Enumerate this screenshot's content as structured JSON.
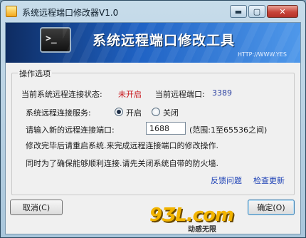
{
  "window": {
    "title": "系统远程端口修改器V1.0",
    "min_label": "▬",
    "max_label": "▢",
    "close_label": "✕"
  },
  "banner": {
    "prompt": ">_",
    "title": "系统远程端口修改工具",
    "url": "HTTP://WWW.YES"
  },
  "options": {
    "group_label": "操作选项",
    "status_label": "当前系统远程连接状态:",
    "status_value": "未开启",
    "port_label": "当前远程端口:",
    "port_value": "3389",
    "service_label": "系统远程连接服务:",
    "radio_on": "开启",
    "radio_off": "关闭",
    "radio_selected": "开启",
    "new_port_label": "请输入新的远程连接端口:",
    "new_port_value": "1688",
    "range_hint": "(范围:1至65536之间)",
    "note1": "修改完毕后请重启系统.来完成远程连接端口的修改操作.",
    "note2": "同时为了确保能够顺利连接.请先关闭系统自带的防火墙.",
    "feedback_link": "反馈问题",
    "update_link": "检查更新"
  },
  "footer": {
    "cancel_label": "取消(C)",
    "ok_label": "确定(O)",
    "watermark": "9ƷL.com",
    "watermark_sub": "动感无限"
  },
  "colors": {
    "status_off": "#c8141a",
    "port_value": "#2a3fa0",
    "link": "#1a3fb5"
  }
}
